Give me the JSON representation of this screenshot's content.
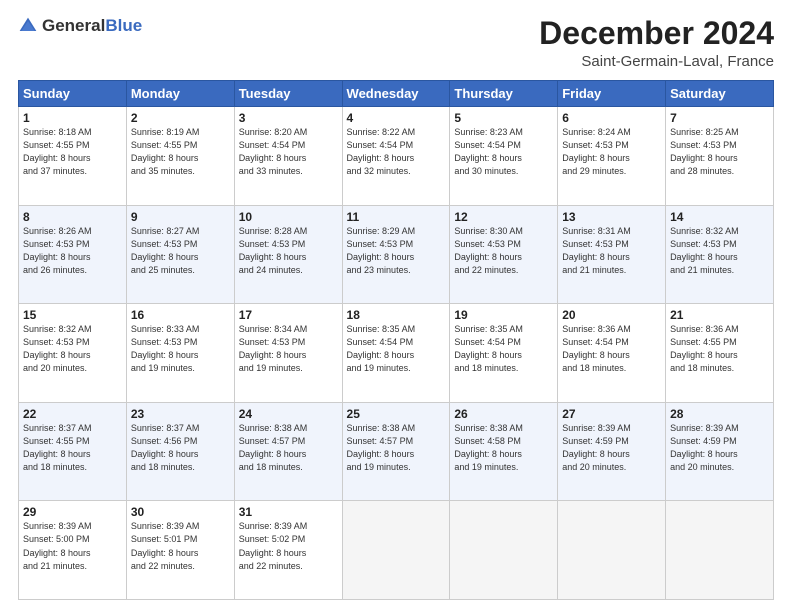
{
  "header": {
    "logo_general": "General",
    "logo_blue": "Blue",
    "month_title": "December 2024",
    "location": "Saint-Germain-Laval, France"
  },
  "days_of_week": [
    "Sunday",
    "Monday",
    "Tuesday",
    "Wednesday",
    "Thursday",
    "Friday",
    "Saturday"
  ],
  "weeks": [
    [
      {
        "day": "1",
        "sunrise": "8:18 AM",
        "sunset": "4:55 PM",
        "daylight": "8 hours and 37 minutes."
      },
      {
        "day": "2",
        "sunrise": "8:19 AM",
        "sunset": "4:55 PM",
        "daylight": "8 hours and 35 minutes."
      },
      {
        "day": "3",
        "sunrise": "8:20 AM",
        "sunset": "4:54 PM",
        "daylight": "8 hours and 33 minutes."
      },
      {
        "day": "4",
        "sunrise": "8:22 AM",
        "sunset": "4:54 PM",
        "daylight": "8 hours and 32 minutes."
      },
      {
        "day": "5",
        "sunrise": "8:23 AM",
        "sunset": "4:54 PM",
        "daylight": "8 hours and 30 minutes."
      },
      {
        "day": "6",
        "sunrise": "8:24 AM",
        "sunset": "4:53 PM",
        "daylight": "8 hours and 29 minutes."
      },
      {
        "day": "7",
        "sunrise": "8:25 AM",
        "sunset": "4:53 PM",
        "daylight": "8 hours and 28 minutes."
      }
    ],
    [
      {
        "day": "8",
        "sunrise": "8:26 AM",
        "sunset": "4:53 PM",
        "daylight": "8 hours and 26 minutes."
      },
      {
        "day": "9",
        "sunrise": "8:27 AM",
        "sunset": "4:53 PM",
        "daylight": "8 hours and 25 minutes."
      },
      {
        "day": "10",
        "sunrise": "8:28 AM",
        "sunset": "4:53 PM",
        "daylight": "8 hours and 24 minutes."
      },
      {
        "day": "11",
        "sunrise": "8:29 AM",
        "sunset": "4:53 PM",
        "daylight": "8 hours and 23 minutes."
      },
      {
        "day": "12",
        "sunrise": "8:30 AM",
        "sunset": "4:53 PM",
        "daylight": "8 hours and 22 minutes."
      },
      {
        "day": "13",
        "sunrise": "8:31 AM",
        "sunset": "4:53 PM",
        "daylight": "8 hours and 21 minutes."
      },
      {
        "day": "14",
        "sunrise": "8:32 AM",
        "sunset": "4:53 PM",
        "daylight": "8 hours and 21 minutes."
      }
    ],
    [
      {
        "day": "15",
        "sunrise": "8:32 AM",
        "sunset": "4:53 PM",
        "daylight": "8 hours and 20 minutes."
      },
      {
        "day": "16",
        "sunrise": "8:33 AM",
        "sunset": "4:53 PM",
        "daylight": "8 hours and 19 minutes."
      },
      {
        "day": "17",
        "sunrise": "8:34 AM",
        "sunset": "4:53 PM",
        "daylight": "8 hours and 19 minutes."
      },
      {
        "day": "18",
        "sunrise": "8:35 AM",
        "sunset": "4:54 PM",
        "daylight": "8 hours and 19 minutes."
      },
      {
        "day": "19",
        "sunrise": "8:35 AM",
        "sunset": "4:54 PM",
        "daylight": "8 hours and 18 minutes."
      },
      {
        "day": "20",
        "sunrise": "8:36 AM",
        "sunset": "4:54 PM",
        "daylight": "8 hours and 18 minutes."
      },
      {
        "day": "21",
        "sunrise": "8:36 AM",
        "sunset": "4:55 PM",
        "daylight": "8 hours and 18 minutes."
      }
    ],
    [
      {
        "day": "22",
        "sunrise": "8:37 AM",
        "sunset": "4:55 PM",
        "daylight": "8 hours and 18 minutes."
      },
      {
        "day": "23",
        "sunrise": "8:37 AM",
        "sunset": "4:56 PM",
        "daylight": "8 hours and 18 minutes."
      },
      {
        "day": "24",
        "sunrise": "8:38 AM",
        "sunset": "4:57 PM",
        "daylight": "8 hours and 18 minutes."
      },
      {
        "day": "25",
        "sunrise": "8:38 AM",
        "sunset": "4:57 PM",
        "daylight": "8 hours and 19 minutes."
      },
      {
        "day": "26",
        "sunrise": "8:38 AM",
        "sunset": "4:58 PM",
        "daylight": "8 hours and 19 minutes."
      },
      {
        "day": "27",
        "sunrise": "8:39 AM",
        "sunset": "4:59 PM",
        "daylight": "8 hours and 20 minutes."
      },
      {
        "day": "28",
        "sunrise": "8:39 AM",
        "sunset": "4:59 PM",
        "daylight": "8 hours and 20 minutes."
      }
    ],
    [
      {
        "day": "29",
        "sunrise": "8:39 AM",
        "sunset": "5:00 PM",
        "daylight": "8 hours and 21 minutes."
      },
      {
        "day": "30",
        "sunrise": "8:39 AM",
        "sunset": "5:01 PM",
        "daylight": "8 hours and 22 minutes."
      },
      {
        "day": "31",
        "sunrise": "8:39 AM",
        "sunset": "5:02 PM",
        "daylight": "8 hours and 22 minutes."
      },
      null,
      null,
      null,
      null
    ]
  ]
}
